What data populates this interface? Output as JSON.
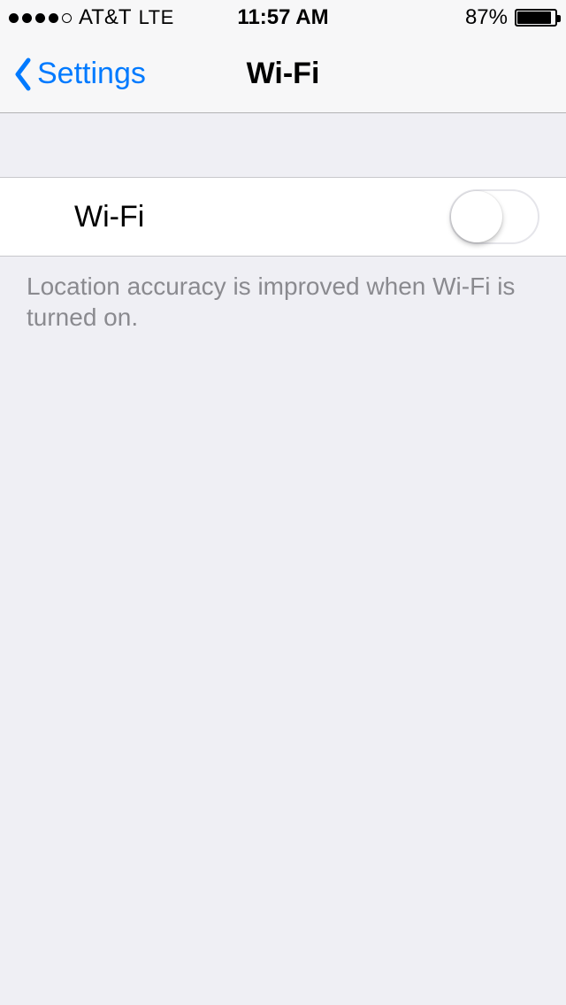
{
  "status_bar": {
    "carrier": "AT&T",
    "network": "LTE",
    "time": "11:57 AM",
    "battery_pct": "87%",
    "battery_fill_pct": 87,
    "signal_filled": 4,
    "signal_total": 5
  },
  "nav": {
    "back_label": "Settings",
    "title": "Wi-Fi"
  },
  "wifi_row": {
    "label": "Wi-Fi",
    "enabled": false
  },
  "footer_text": "Location accuracy is improved when Wi-Fi is turned on.",
  "colors": {
    "tint": "#007aff",
    "bg": "#efeff4",
    "cell_bg": "#ffffff"
  }
}
